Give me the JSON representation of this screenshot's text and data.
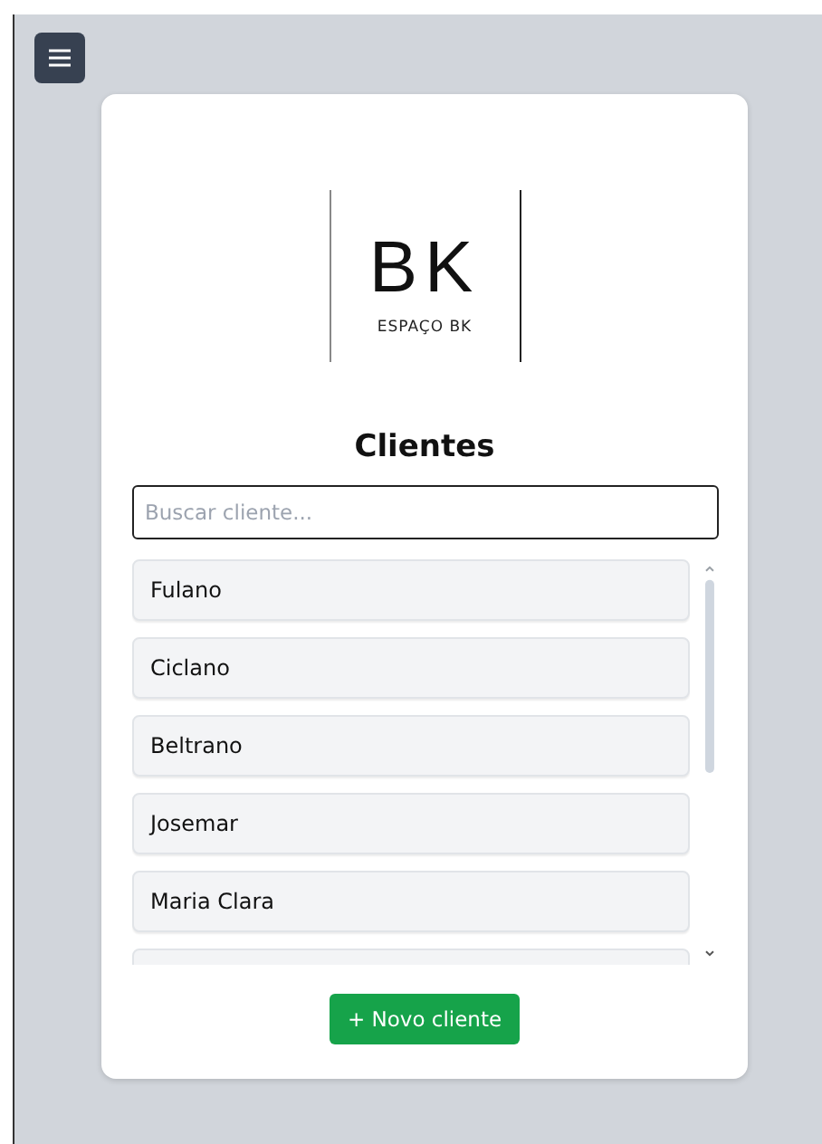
{
  "logo": {
    "mark": "BK",
    "name": "ESPAÇO BK"
  },
  "title": "Clientes",
  "search": {
    "placeholder": "Buscar cliente..."
  },
  "clients": [
    {
      "name": "Fulano"
    },
    {
      "name": "Ciclano"
    },
    {
      "name": "Beltrano"
    },
    {
      "name": "Josemar"
    },
    {
      "name": "Maria Clara"
    }
  ],
  "new_button": "+ Novo cliente"
}
